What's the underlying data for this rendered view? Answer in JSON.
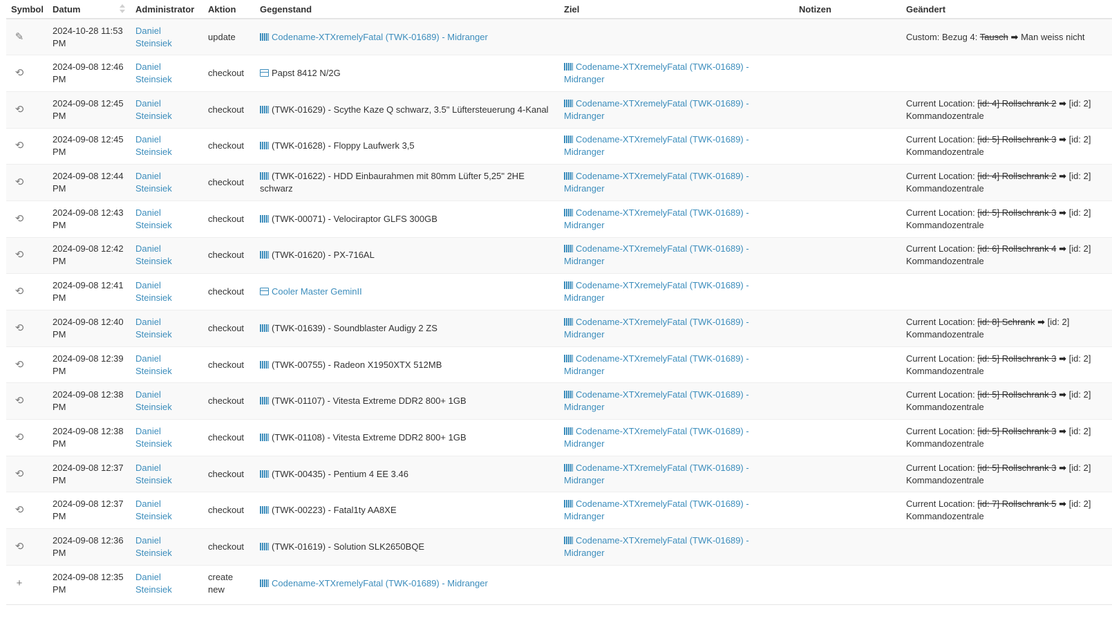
{
  "columns": {
    "symbol": "Symbol",
    "datum": "Datum",
    "administrator": "Administrator",
    "aktion": "Aktion",
    "gegenstand": "Gegenstand",
    "ziel": "Ziel",
    "notizen": "Notizen",
    "geaendert": "Geändert"
  },
  "rows": [
    {
      "icon": "pencil-icon",
      "glyph": "✎",
      "date": "2024-10-28 11:53 PM",
      "admin": "Daniel Steinsiek",
      "action": "update",
      "item": "Codename-XTXremelyFatal (TWK-01689) - Midranger",
      "item_type": "asset-icon",
      "item_link": true,
      "target": "",
      "note": "",
      "change": {
        "label": "Custom: Bezug 4: ",
        "old": "Tausch",
        "new": " Man weiss nicht",
        "tail": ""
      }
    },
    {
      "icon": "undo-icon",
      "glyph": "⟲",
      "date": "2024-09-08 12:46 PM",
      "admin": "Daniel Steinsiek",
      "action": "checkout",
      "item": "Papst 8412 N/2G",
      "item_type": "component-icon",
      "item_link": false,
      "target": "Codename-XTXremelyFatal (TWK-01689) - Midranger",
      "note": "",
      "change": null
    },
    {
      "icon": "undo-icon",
      "glyph": "⟲",
      "date": "2024-09-08 12:45 PM",
      "admin": "Daniel Steinsiek",
      "action": "checkout",
      "item": "(TWK-01629) - Scythe Kaze Q schwarz, 3.5\" Lüftersteuerung 4-Kanal",
      "item_type": "asset-icon",
      "item_link": false,
      "target": "Codename-XTXremelyFatal (TWK-01689) - Midranger",
      "note": "",
      "change": {
        "label": "Current Location: ",
        "old": "[id: 4] Rollschrank 2",
        "new": " [id: 2]",
        "tail": "Kommandozentrale"
      }
    },
    {
      "icon": "undo-icon",
      "glyph": "⟲",
      "date": "2024-09-08 12:45 PM",
      "admin": "Daniel Steinsiek",
      "action": "checkout",
      "item": "(TWK-01628) - Floppy Laufwerk 3,5",
      "item_type": "asset-icon",
      "item_link": false,
      "target": "Codename-XTXremelyFatal (TWK-01689) - Midranger",
      "note": "",
      "change": {
        "label": "Current Location: ",
        "old": "[id: 5] Rollschrank 3",
        "new": " [id: 2]",
        "tail": "Kommandozentrale"
      }
    },
    {
      "icon": "undo-icon",
      "glyph": "⟲",
      "date": "2024-09-08 12:44 PM",
      "admin": "Daniel Steinsiek",
      "action": "checkout",
      "item": "(TWK-01622) - HDD Einbaurahmen mit 80mm Lüfter 5,25\" 2HE schwarz",
      "item_type": "asset-icon",
      "item_link": false,
      "target": "Codename-XTXremelyFatal (TWK-01689) - Midranger",
      "note": "",
      "change": {
        "label": "Current Location: ",
        "old": "[id: 4] Rollschrank 2",
        "new": " [id: 2]",
        "tail": "Kommandozentrale"
      }
    },
    {
      "icon": "undo-icon",
      "glyph": "⟲",
      "date": "2024-09-08 12:43 PM",
      "admin": "Daniel Steinsiek",
      "action": "checkout",
      "item": "(TWK-00071) - Velociraptor GLFS 300GB",
      "item_type": "asset-icon",
      "item_link": false,
      "target": "Codename-XTXremelyFatal (TWK-01689) - Midranger",
      "note": "",
      "change": {
        "label": "Current Location: ",
        "old": "[id: 5] Rollschrank 3",
        "new": " [id: 2]",
        "tail": "Kommandozentrale"
      }
    },
    {
      "icon": "undo-icon",
      "glyph": "⟲",
      "date": "2024-09-08 12:42 PM",
      "admin": "Daniel Steinsiek",
      "action": "checkout",
      "item": "(TWK-01620) - PX-716AL",
      "item_type": "asset-icon",
      "item_link": false,
      "target": "Codename-XTXremelyFatal (TWK-01689) - Midranger",
      "note": "",
      "change": {
        "label": "Current Location: ",
        "old": "[id: 6] Rollschrank 4",
        "new": " [id: 2]",
        "tail": "Kommandozentrale"
      }
    },
    {
      "icon": "undo-icon",
      "glyph": "⟲",
      "date": "2024-09-08 12:41 PM",
      "admin": "Daniel Steinsiek",
      "action": "checkout",
      "item": "Cooler Master GeminII",
      "item_type": "component-icon",
      "item_link": true,
      "target": "Codename-XTXremelyFatal (TWK-01689) - Midranger",
      "note": "",
      "change": null
    },
    {
      "icon": "undo-icon",
      "glyph": "⟲",
      "date": "2024-09-08 12:40 PM",
      "admin": "Daniel Steinsiek",
      "action": "checkout",
      "item": "(TWK-01639) - Soundblaster Audigy 2 ZS",
      "item_type": "asset-icon",
      "item_link": false,
      "target": "Codename-XTXremelyFatal (TWK-01689) - Midranger",
      "note": "",
      "change": {
        "label": "Current Location: ",
        "old": "[id: 8] Schrank",
        "new": " [id: 2]",
        "tail": "Kommandozentrale"
      }
    },
    {
      "icon": "undo-icon",
      "glyph": "⟲",
      "date": "2024-09-08 12:39 PM",
      "admin": "Daniel Steinsiek",
      "action": "checkout",
      "item": "(TWK-00755) - Radeon X1950XTX 512MB",
      "item_type": "asset-icon",
      "item_link": false,
      "target": "Codename-XTXremelyFatal (TWK-01689) - Midranger",
      "note": "",
      "change": {
        "label": "Current Location: ",
        "old": "[id: 5] Rollschrank 3",
        "new": " [id: 2]",
        "tail": "Kommandozentrale"
      }
    },
    {
      "icon": "undo-icon",
      "glyph": "⟲",
      "date": "2024-09-08 12:38 PM",
      "admin": "Daniel Steinsiek",
      "action": "checkout",
      "item": "(TWK-01107) - Vitesta Extreme DDR2 800+ 1GB",
      "item_type": "asset-icon",
      "item_link": false,
      "target": "Codename-XTXremelyFatal (TWK-01689) - Midranger",
      "note": "",
      "change": {
        "label": "Current Location: ",
        "old": "[id: 5] Rollschrank 3",
        "new": " [id: 2]",
        "tail": "Kommandozentrale"
      }
    },
    {
      "icon": "undo-icon",
      "glyph": "⟲",
      "date": "2024-09-08 12:38 PM",
      "admin": "Daniel Steinsiek",
      "action": "checkout",
      "item": "(TWK-01108) - Vitesta Extreme DDR2 800+ 1GB",
      "item_type": "asset-icon",
      "item_link": false,
      "target": "Codename-XTXremelyFatal (TWK-01689) - Midranger",
      "note": "",
      "change": {
        "label": "Current Location: ",
        "old": "[id: 5] Rollschrank 3",
        "new": " [id: 2]",
        "tail": "Kommandozentrale"
      }
    },
    {
      "icon": "undo-icon",
      "glyph": "⟲",
      "date": "2024-09-08 12:37 PM",
      "admin": "Daniel Steinsiek",
      "action": "checkout",
      "item": "(TWK-00435) - Pentium 4 EE 3.46",
      "item_type": "asset-icon",
      "item_link": false,
      "target": "Codename-XTXremelyFatal (TWK-01689) - Midranger",
      "note": "",
      "change": {
        "label": "Current Location: ",
        "old": "[id: 5] Rollschrank 3",
        "new": " [id: 2]",
        "tail": "Kommandozentrale"
      }
    },
    {
      "icon": "undo-icon",
      "glyph": "⟲",
      "date": "2024-09-08 12:37 PM",
      "admin": "Daniel Steinsiek",
      "action": "checkout",
      "item": "(TWK-00223) - Fatal1ty AA8XE",
      "item_type": "asset-icon",
      "item_link": false,
      "target": "Codename-XTXremelyFatal (TWK-01689) - Midranger",
      "note": "",
      "change": {
        "label": "Current Location: ",
        "old": "[id: 7] Rollschrank 5",
        "new": " [id: 2]",
        "tail": "Kommandozentrale"
      }
    },
    {
      "icon": "undo-icon",
      "glyph": "⟲",
      "date": "2024-09-08 12:36 PM",
      "admin": "Daniel Steinsiek",
      "action": "checkout",
      "item": "(TWK-01619) - Solution SLK2650BQE",
      "item_type": "asset-icon",
      "item_link": false,
      "target": "Codename-XTXremelyFatal (TWK-01689) - Midranger",
      "note": "",
      "change": null
    },
    {
      "icon": "plus-icon",
      "glyph": "+",
      "date": "2024-09-08 12:35 PM",
      "admin": "Daniel Steinsiek",
      "action": "create new",
      "item": "Codename-XTXremelyFatal (TWK-01689) - Midranger",
      "item_type": "asset-icon",
      "item_link": true,
      "target": "",
      "note": "",
      "change": null
    }
  ],
  "colors": {
    "link": "#3c8dbc",
    "text": "#333333",
    "stripe": "#f9f9f9"
  }
}
